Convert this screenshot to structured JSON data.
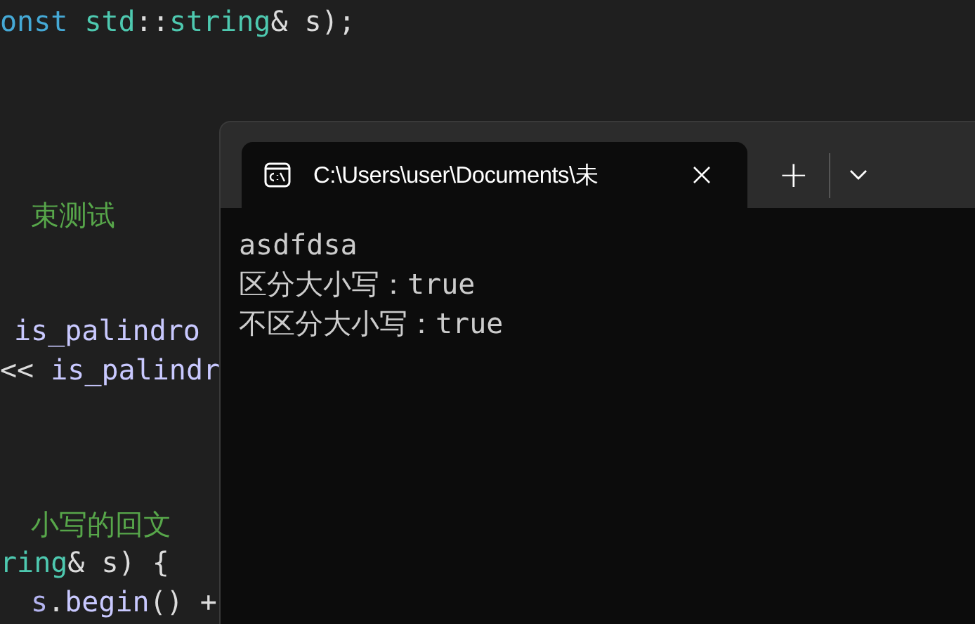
{
  "editor": {
    "lines": [
      {
        "tokens": [
          {
            "text": "onst",
            "kind": "keyword"
          },
          {
            "text": " std",
            "kind": "type"
          },
          {
            "text": "::",
            "kind": "plain"
          },
          {
            "text": "string",
            "kind": "type"
          },
          {
            "text": "& s);",
            "kind": "plain"
          }
        ]
      },
      {
        "tokens": [
          {
            "text": "束测试",
            "kind": "comment"
          }
        ]
      },
      {
        "tokens": [
          {
            "text": "is_palindro",
            "kind": "function"
          }
        ]
      },
      {
        "tokens": [
          {
            "text": "<< ",
            "kind": "plain"
          },
          {
            "text": "is_palindr",
            "kind": "function"
          }
        ]
      },
      {
        "tokens": [
          {
            "text": "小写的回文",
            "kind": "comment"
          }
        ]
      },
      {
        "tokens": [
          {
            "text": "ring",
            "kind": "type"
          },
          {
            "text": "& s) {",
            "kind": "plain"
          }
        ]
      },
      {
        "tokens": [
          {
            "text": "s",
            "kind": "variable"
          },
          {
            "text": ".",
            "kind": "plain"
          },
          {
            "text": "begin",
            "kind": "function"
          },
          {
            "text": "() +",
            "kind": "plain"
          }
        ]
      }
    ]
  },
  "terminal": {
    "tabs": [
      {
        "title": "C:\\Users\\user\\Documents\\未",
        "selected": true
      }
    ],
    "new_tab": "+",
    "output": [
      "asdfdsa",
      "区分大小写：true",
      "不区分大小写：true"
    ]
  }
}
